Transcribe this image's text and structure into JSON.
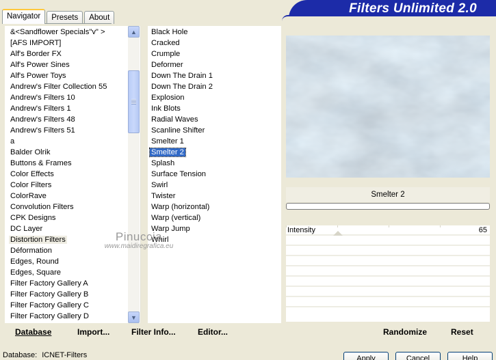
{
  "window": {
    "title": "Filters Unlimited 2.0",
    "tabs": [
      "Navigator",
      "Presets",
      "About"
    ],
    "active_tab": "Navigator"
  },
  "categories": [
    "&<Sandflower Specials\"v\" >",
    "[AFS IMPORT]",
    "Alf's Border FX",
    "Alf's Power Sines",
    "Alf's Power Toys",
    "Andrew's Filter Collection 55",
    "Andrew's Filters 10",
    "Andrew's Filters 1",
    "Andrew's Filters 48",
    "Andrew's Filters 51",
    "a",
    "Balder Olrik",
    "Buttons & Frames",
    "Color Effects",
    "Color Filters",
    "ColorRave",
    "Convolution Filters",
    "CPK Designs",
    "DC Layer",
    "Distortion Filters",
    "Déformation",
    "Edges, Round",
    "Edges, Square",
    "Filter Factory Gallery A",
    "Filter Factory Gallery B",
    "Filter Factory Gallery C",
    "Filter Factory Gallery D"
  ],
  "selected_category": "Distortion Filters",
  "filters": [
    "Black Hole",
    "Cracked",
    "Crumple",
    "Deformer",
    "Down The Drain 1",
    "Down The Drain 2",
    "Explosion",
    "Ink Blots",
    "Radial Waves",
    "Scanline Shifter",
    "Smelter 1",
    "Smelter 2",
    "Splash",
    "Surface Tension",
    "Swirl",
    "Twister",
    "Warp (horizontal)",
    "Warp (vertical)",
    "Warp Jump",
    "Whirl"
  ],
  "selected_filter": "Smelter 2",
  "preview": {
    "filter_name": "Smelter 2"
  },
  "sliders": [
    {
      "label": "Intensity",
      "value": "65"
    }
  ],
  "watermark": {
    "name": "Pinuccia",
    "url": "www.maidiregrafica.eu"
  },
  "toolbar": {
    "database": "Database",
    "import": "Import...",
    "filter_info": "Filter Info...",
    "editor": "Editor...",
    "randomize": "Randomize",
    "reset": "Reset"
  },
  "status": {
    "label": "Database:",
    "value": "ICNET-Filters"
  },
  "dialog": {
    "apply": "Apply",
    "cancel": "Cancel",
    "help": "Help"
  },
  "colors": {
    "banner": "#1C2BA8",
    "selection": "#3169C6",
    "window_bg": "#ECE9D8"
  }
}
